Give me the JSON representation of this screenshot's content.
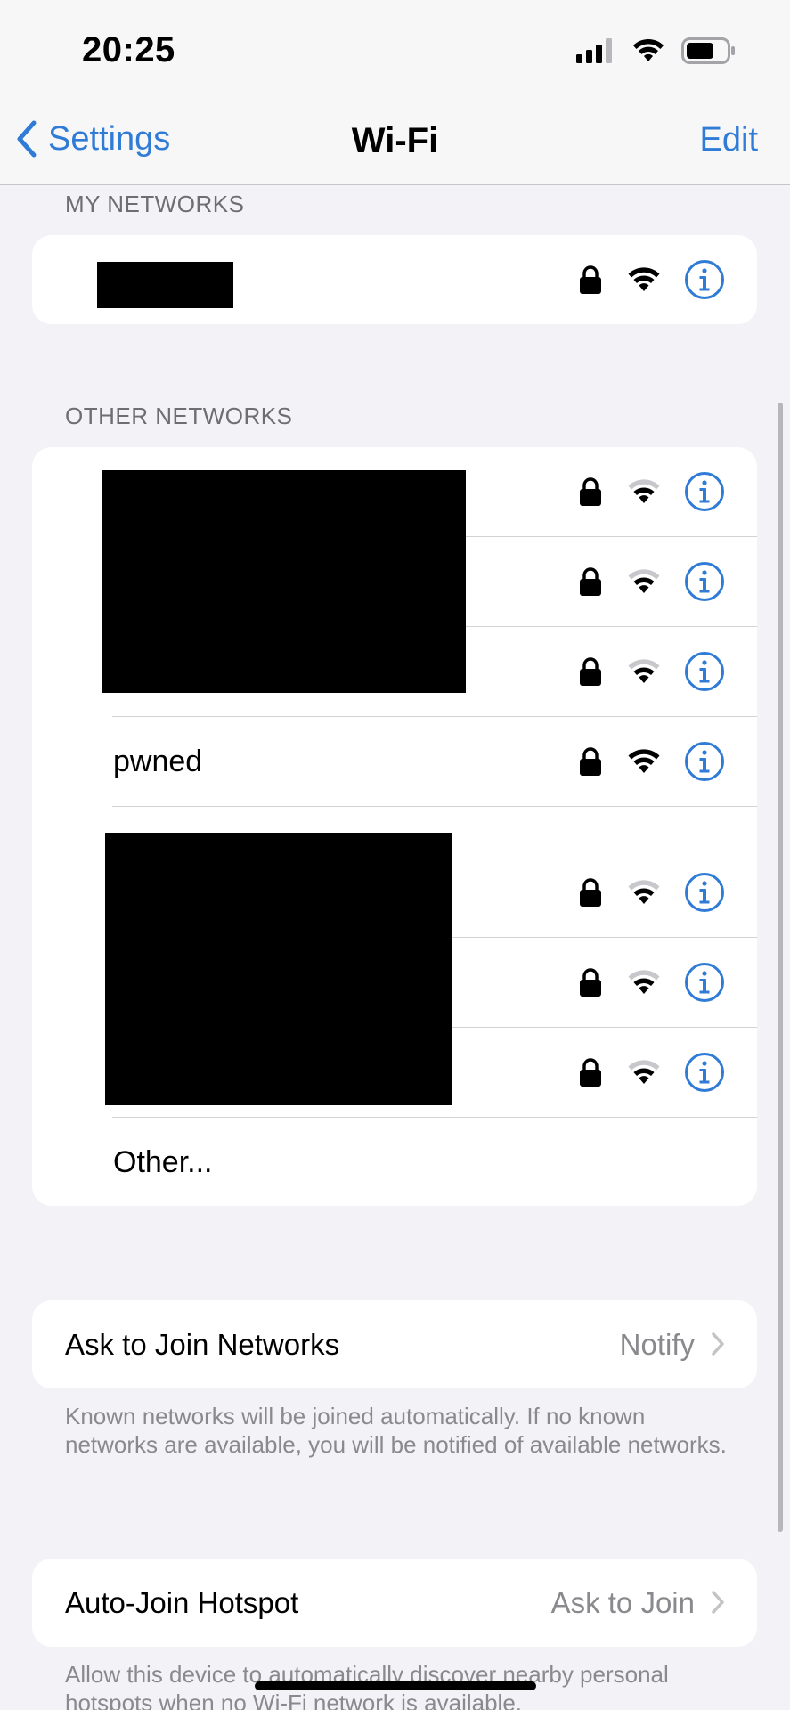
{
  "status_bar": {
    "time": "20:25"
  },
  "nav": {
    "back_label": "Settings",
    "title": "Wi-Fi",
    "edit_label": "Edit"
  },
  "my_networks": {
    "header": "MY NETWORKS",
    "networks": [
      {
        "name": "",
        "redacted": true,
        "locked": true,
        "signal": "strong"
      }
    ]
  },
  "other_networks": {
    "header": "OTHER NETWORKS",
    "networks": [
      {
        "name": "",
        "redacted": true,
        "locked": true,
        "signal": "weak"
      },
      {
        "name": "",
        "redacted": true,
        "locked": true,
        "signal": "weak"
      },
      {
        "name": "",
        "redacted": true,
        "locked": true,
        "signal": "weak"
      },
      {
        "name": "pwned",
        "redacted": false,
        "locked": true,
        "signal": "strong"
      },
      {
        "name": "",
        "redacted": true,
        "locked": true,
        "signal": "weak"
      },
      {
        "name": "",
        "redacted": true,
        "locked": true,
        "signal": "weak"
      },
      {
        "name": "",
        "redacted": true,
        "locked": true,
        "signal": "weak"
      }
    ],
    "other_label": "Other..."
  },
  "ask_to_join": {
    "label": "Ask to Join Networks",
    "value": "Notify",
    "footnote": "Known networks will be joined automatically. If no known networks are available, you will be notified of available networks."
  },
  "auto_join_hotspot": {
    "label": "Auto-Join Hotspot",
    "value": "Ask to Join",
    "footnote": "Allow this device to automatically discover nearby personal hotspots when no Wi-Fi network is available."
  },
  "colors": {
    "accent": "#2f7bd6",
    "background": "#f2f2f7",
    "secondary_text": "#8a8a8e"
  }
}
